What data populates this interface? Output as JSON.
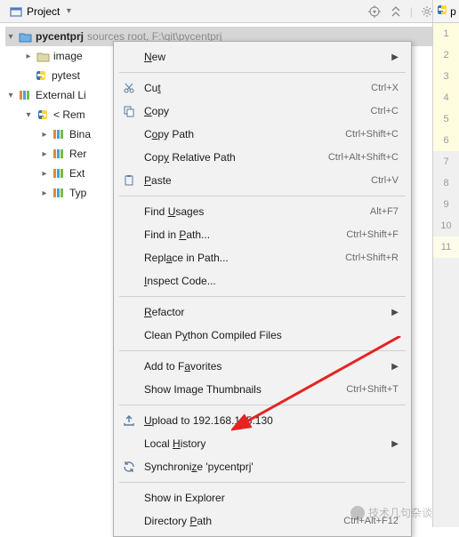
{
  "toolbar": {
    "project_label": "Project"
  },
  "tree": {
    "root": {
      "name": "pycentprj",
      "hint": "sources root,  F:\\git\\pycentprj"
    },
    "children": [
      "image",
      "pytest"
    ],
    "external_label": "External Li",
    "remote_label": "< Rem",
    "remote_children": [
      "Bina",
      "Rer",
      "Ext",
      "Typ"
    ]
  },
  "editor": {
    "tab_prefix": "p",
    "lines": [
      "1",
      "2",
      "3",
      "4",
      "5",
      "6",
      "7",
      "8",
      "9",
      "10",
      "11"
    ]
  },
  "menu": {
    "items": [
      {
        "icon": "",
        "label": "<u class='mn'>N</u>ew",
        "shortcut": "",
        "sub": true
      },
      {
        "sep": true
      },
      {
        "icon": "cut",
        "label": "Cu<u class='mn'>t</u>",
        "shortcut": "Ctrl+X"
      },
      {
        "icon": "copy",
        "label": "<u class='mn'>C</u>opy",
        "shortcut": "Ctrl+C"
      },
      {
        "icon": "",
        "label": "C<u class='mn'>o</u>py Path",
        "shortcut": "Ctrl+Shift+C"
      },
      {
        "icon": "",
        "label": "Cop<u class='mn'>y</u> Relative Path",
        "shortcut": "Ctrl+Alt+Shift+C"
      },
      {
        "icon": "paste",
        "label": "<u class='mn'>P</u>aste",
        "shortcut": "Ctrl+V"
      },
      {
        "sep": true
      },
      {
        "icon": "",
        "label": "Find <u class='mn'>U</u>sages",
        "shortcut": "Alt+F7"
      },
      {
        "icon": "",
        "label": "Find in <u class='mn'>P</u>ath...",
        "shortcut": "Ctrl+Shift+F"
      },
      {
        "icon": "",
        "label": "Repl<u class='mn'>a</u>ce in Path...",
        "shortcut": "Ctrl+Shift+R"
      },
      {
        "icon": "",
        "label": "<u class='mn'>I</u>nspect Code...",
        "shortcut": ""
      },
      {
        "sep": true
      },
      {
        "icon": "",
        "label": "<u class='mn'>R</u>efactor",
        "shortcut": "",
        "sub": true
      },
      {
        "icon": "",
        "label": "Clean P<u class='mn'>y</u>thon Compiled Files",
        "shortcut": ""
      },
      {
        "sep": true
      },
      {
        "icon": "",
        "label": "Add to F<u class='mn'>a</u>vorites",
        "shortcut": "",
        "sub": true
      },
      {
        "icon": "",
        "label": "Show Image Thumbnails",
        "shortcut": "Ctrl+Shift+T"
      },
      {
        "sep": true
      },
      {
        "icon": "upload",
        "label": "<u class='mn'>U</u>pload to 192.168.105.130",
        "shortcut": ""
      },
      {
        "icon": "",
        "label": "Local <u class='mn'>H</u>istory",
        "shortcut": "",
        "sub": true
      },
      {
        "icon": "sync",
        "label": "Synchroni<u class='mn'>z</u>e 'pycentprj'",
        "shortcut": ""
      },
      {
        "sep": true
      },
      {
        "icon": "",
        "label": "Show in Explorer",
        "shortcut": ""
      },
      {
        "icon": "",
        "label": "Directory <u class='mn'>P</u>ath",
        "shortcut": "Ctrl+Alt+F12"
      }
    ]
  },
  "watermark": "技术几句杂谈"
}
